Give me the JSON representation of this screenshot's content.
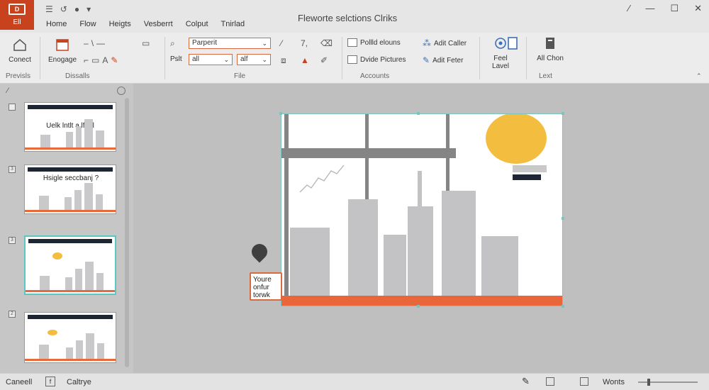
{
  "app": {
    "file_tab": "Ell",
    "file_logo": "D",
    "document_title": "Fleworte selctions Clriks",
    "tabs": [
      "Home",
      "Flow",
      "Heigts",
      "Vesberrt",
      "Colput",
      "Tnirlad"
    ],
    "window_controls": [
      "⁄",
      "—",
      "☐",
      "✕"
    ]
  },
  "ribbon": {
    "groups": [
      "Previsls",
      "Dissalls",
      "File",
      "Accounts",
      "Lext"
    ],
    "connect_label": "Conect",
    "engage_label": "Enogage",
    "pst_label": "Pslt",
    "font_name": "Parperit",
    "font_size_1": "all",
    "font_size_2": "alf",
    "fold_docs": "Pollld elouns",
    "divide_pictures": "Dvide Pictures",
    "add_gallery": "Adit Caller",
    "add_footer": "Adit Feter",
    "feel_level": "Feel Lavel",
    "all_chroma": "All Chon"
  },
  "status": {
    "cancel": "Caneell",
    "capture": "Caltrye",
    "words": "Wonts",
    "zoom_percent": 15
  },
  "slides": [
    {
      "num": "",
      "title": "Uelk lntlt a lfeol"
    },
    {
      "num": "3",
      "title": "Hsigle seccbanj ?"
    },
    {
      "num": "3",
      "title": ""
    },
    {
      "num": "2",
      "title": ""
    }
  ],
  "canvas": {
    "callout_text": "Youre onfur torwk"
  }
}
